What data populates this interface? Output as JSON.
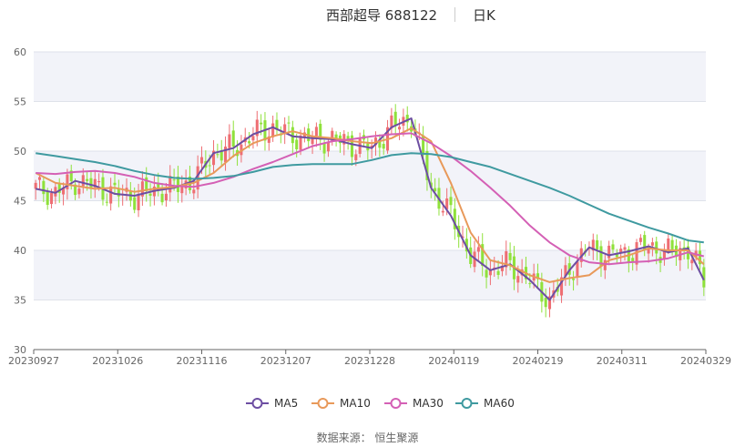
{
  "header": {
    "title": "西部超导 688122",
    "period": "日K"
  },
  "footer": {
    "source": "数据来源： 恒生聚源"
  },
  "colors": {
    "up": "#ee6e73",
    "down": "#8fe13b",
    "ma5": "#6d4ea2",
    "ma10": "#e8995a",
    "ma30": "#d460b5",
    "ma60": "#3f9aa0",
    "band": "#f2f3f9",
    "grid": "#dfe2ea"
  },
  "chart_data": {
    "type": "candlestick",
    "ylim": [
      30,
      60
    ],
    "yticks": [
      "60",
      "55",
      "50",
      "45",
      "40",
      "35",
      "30"
    ],
    "xticks": [
      "20230927",
      "20231026",
      "20231116",
      "20231207",
      "20231228",
      "20240119",
      "20240219",
      "20240311",
      "20240329"
    ],
    "legend": [
      "MA5",
      "MA10",
      "MA30",
      "MA60"
    ],
    "legend_position": "bottom",
    "series": [
      {
        "name": "MA5",
        "x": [
          0,
          5,
          10,
          15,
          20,
          25,
          30,
          35,
          40,
          45,
          50,
          55,
          60,
          65,
          70,
          75,
          80,
          85,
          90,
          95,
          100,
          105,
          110,
          115,
          120,
          125,
          130,
          135,
          140,
          145,
          150,
          155,
          160,
          165,
          169
        ],
        "values": [
          46.2,
          45.8,
          47.0,
          46.5,
          45.7,
          45.5,
          46.0,
          46.3,
          47.0,
          49.8,
          50.3,
          51.7,
          52.4,
          51.5,
          51.3,
          51.2,
          50.7,
          50.3,
          52.4,
          53.3,
          46.3,
          43.5,
          39.5,
          38.0,
          38.6,
          37.0,
          35.0,
          38.0,
          40.3,
          39.5,
          39.9,
          40.4,
          39.8,
          40.2,
          37.0
        ]
      },
      {
        "name": "MA10",
        "x": [
          0,
          5,
          10,
          15,
          20,
          25,
          30,
          35,
          40,
          45,
          50,
          55,
          60,
          65,
          70,
          75,
          80,
          85,
          90,
          95,
          100,
          105,
          110,
          115,
          120,
          125,
          130,
          135,
          140,
          145,
          150,
          155,
          160,
          165,
          169
        ],
        "values": [
          47.8,
          46.8,
          46.5,
          46.2,
          46.3,
          45.9,
          46.2,
          46.4,
          46.8,
          47.8,
          49.5,
          50.8,
          51.5,
          52.0,
          51.5,
          51.3,
          51.0,
          50.8,
          51.3,
          52.3,
          51.0,
          46.8,
          41.8,
          39.0,
          38.5,
          37.5,
          36.8,
          37.2,
          37.5,
          39.0,
          39.5,
          40.2,
          40.0,
          40.0,
          38.6
        ]
      },
      {
        "name": "MA30",
        "x": [
          0,
          5,
          10,
          15,
          20,
          25,
          30,
          35,
          40,
          45,
          50,
          55,
          60,
          65,
          70,
          75,
          80,
          85,
          90,
          95,
          100,
          105,
          110,
          115,
          120,
          125,
          130,
          135,
          140,
          145,
          150,
          155,
          160,
          165,
          169
        ],
        "values": [
          47.8,
          47.7,
          47.9,
          48.0,
          47.8,
          47.4,
          46.8,
          46.5,
          46.4,
          46.8,
          47.4,
          48.2,
          48.9,
          49.7,
          50.5,
          51.0,
          51.2,
          51.5,
          51.7,
          51.8,
          50.8,
          49.5,
          48.0,
          46.3,
          44.5,
          42.5,
          40.8,
          39.5,
          38.8,
          38.6,
          38.8,
          38.9,
          39.2,
          39.8,
          39.4
        ]
      },
      {
        "name": "MA60",
        "x": [
          0,
          5,
          10,
          15,
          20,
          25,
          30,
          35,
          40,
          45,
          50,
          55,
          60,
          65,
          70,
          75,
          80,
          85,
          90,
          95,
          100,
          105,
          110,
          115,
          120,
          125,
          130,
          135,
          140,
          145,
          150,
          155,
          160,
          165,
          169
        ],
        "values": [
          49.8,
          49.5,
          49.2,
          48.9,
          48.5,
          48.0,
          47.6,
          47.3,
          47.2,
          47.3,
          47.5,
          47.9,
          48.4,
          48.6,
          48.7,
          48.7,
          48.7,
          49.1,
          49.6,
          49.8,
          49.7,
          49.4,
          48.9,
          48.4,
          47.7,
          47.0,
          46.3,
          45.5,
          44.6,
          43.7,
          43.0,
          42.3,
          41.7,
          41.0,
          40.8
        ]
      }
    ]
  }
}
